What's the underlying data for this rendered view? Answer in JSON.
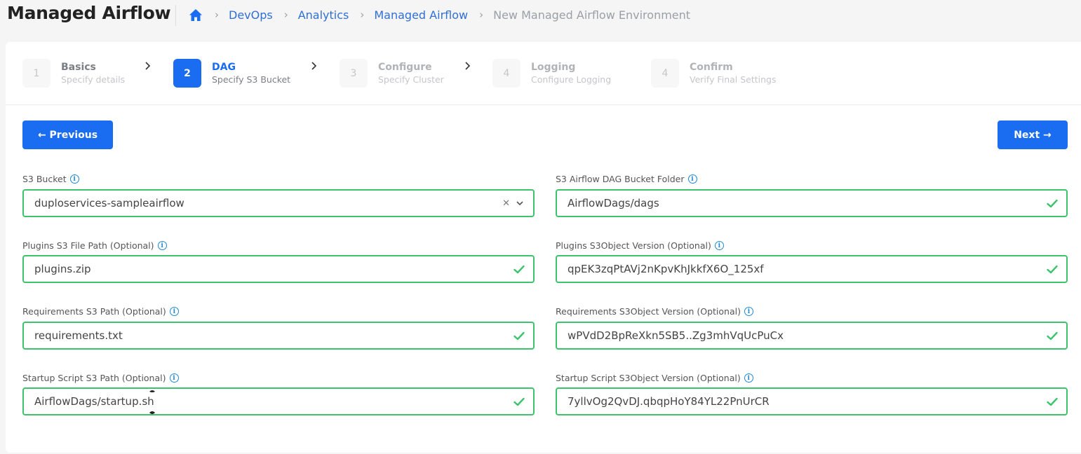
{
  "header": {
    "app_title": "Managed Airflow",
    "breadcrumb": {
      "home_icon": "home-icon",
      "items": [
        "DevOps",
        "Analytics",
        "Managed Airflow"
      ],
      "current": "New Managed Airflow Environment"
    }
  },
  "stepper": {
    "steps": [
      {
        "number": "1",
        "title": "Basics",
        "subtitle": "Specify details",
        "state": "complete"
      },
      {
        "number": "2",
        "title": "DAG",
        "subtitle": "Specify S3 Bucket",
        "state": "active"
      },
      {
        "number": "3",
        "title": "Configure",
        "subtitle": "Specify Cluster",
        "state": "upcoming"
      },
      {
        "number": "4",
        "title": "Logging",
        "subtitle": "Configure Logging",
        "state": "upcoming"
      },
      {
        "number": "4",
        "title": "Confirm",
        "subtitle": "Verify Final Settings",
        "state": "upcoming"
      }
    ]
  },
  "actions": {
    "previous_label": "← Previous",
    "next_label": "Next →"
  },
  "form": {
    "s3_bucket": {
      "label": "S3 Bucket",
      "value": "duploservices-sampleairflow"
    },
    "dag_folder": {
      "label": "S3 Airflow DAG Bucket Folder",
      "value": "AirflowDags/dags"
    },
    "plugins_path": {
      "label": "Plugins S3 File Path (Optional)",
      "value": "plugins.zip"
    },
    "plugins_version": {
      "label": "Plugins S3Object Version (Optional)",
      "value": "qpEK3zqPtAVj2nKpvKhJkkfX6O_125xf"
    },
    "requirements_path": {
      "label": "Requirements S3 Path (Optional)",
      "value": "requirements.txt"
    },
    "requirements_version": {
      "label": "Requirements S3Object Version (Optional)",
      "value": "wPVdD2BpReXkn5SB5..Zg3mhVqUcPuCx"
    },
    "startup_path": {
      "label": "Startup Script S3 Path (Optional)",
      "value": "AirflowDags/startup.sh"
    },
    "startup_version": {
      "label": "Startup Script S3Object Version (Optional)",
      "value": "7yllvOg2QvDJ.qbqpHoY84YL22PnUrCR"
    }
  },
  "colors": {
    "primary": "#1a6cf0",
    "valid_border": "#3cc36b",
    "info": "#1e88d6"
  }
}
